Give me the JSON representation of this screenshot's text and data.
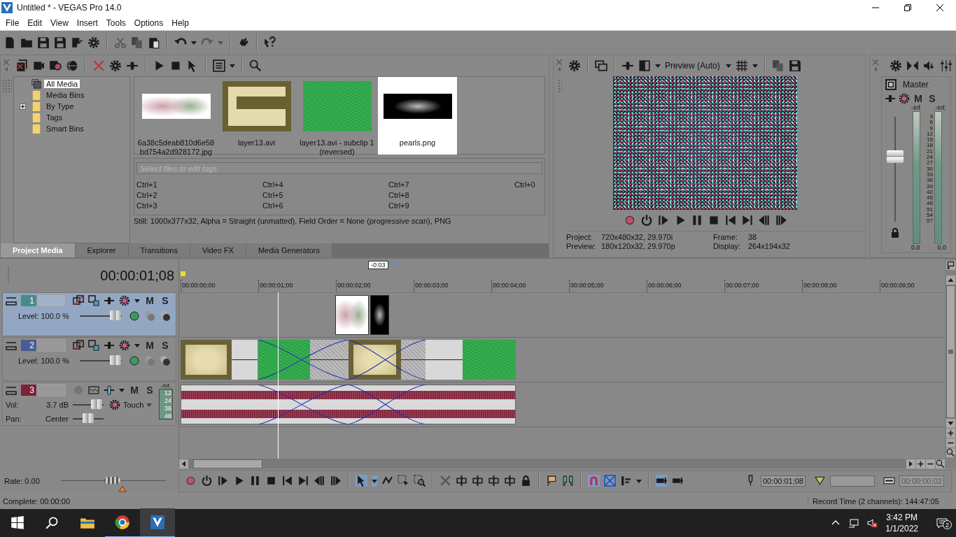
{
  "window": {
    "title": "Untitled * - VEGAS Pro 14.0"
  },
  "menu": [
    "File",
    "Edit",
    "View",
    "Insert",
    "Tools",
    "Options",
    "Help"
  ],
  "media_tree": [
    {
      "label": "All Media",
      "selected": true,
      "expandable": false
    },
    {
      "label": "Media Bins",
      "selected": false,
      "expandable": false
    },
    {
      "label": "By Type",
      "selected": false,
      "expandable": true
    },
    {
      "label": "Tags",
      "selected": false,
      "expandable": false
    },
    {
      "label": "Smart Bins",
      "selected": false,
      "expandable": false
    }
  ],
  "media_files": [
    {
      "name": "6a38c5deab810d6e58bd754a2d928172.jpg",
      "kind": "cartoon",
      "selected": false
    },
    {
      "name": "layer13.avi",
      "kind": "texture",
      "selected": false
    },
    {
      "name": "layer13.avi - subclip 1 (reversed)",
      "kind": "green",
      "selected": false
    },
    {
      "name": "pearls.png",
      "kind": "dark",
      "selected": true
    }
  ],
  "tags": {
    "placeholder": "Select files to edit tags",
    "shortcut_columns": [
      [
        "Ctrl+1",
        "Ctrl+2",
        "Ctrl+3"
      ],
      [
        "Ctrl+4",
        "Ctrl+5",
        "Ctrl+6"
      ],
      [
        "Ctrl+7",
        "Ctrl+8",
        "Ctrl+9"
      ],
      [
        "Ctrl+0"
      ]
    ]
  },
  "media_info": "Still: 1000x377x32, Alpha = Straight (unmatted), Field Order = None (progressive scan), PNG",
  "dock_tabs": [
    {
      "label": "Project Media",
      "selected": true
    },
    {
      "label": "Explorer",
      "selected": false
    },
    {
      "label": "Transitions",
      "selected": false
    },
    {
      "label": "Video FX",
      "selected": false
    },
    {
      "label": "Media Generators",
      "selected": false
    }
  ],
  "preview": {
    "quality": "Preview (Auto)",
    "info_left": [
      {
        "label": "Project:",
        "value": "720x480x32, 29.970i"
      },
      {
        "label": "Preview:",
        "value": "180x120x32, 29.970p"
      }
    ],
    "info_right": [
      {
        "label": "Frame:",
        "value": "38"
      },
      {
        "label": "Display:",
        "value": "264x194x32"
      }
    ]
  },
  "master": {
    "title": "Master",
    "mute": "M",
    "solo": "S",
    "peaks": [
      "-Inf.",
      "-Inf."
    ],
    "scale": [
      "3",
      "6",
      "9",
      "12",
      "15",
      "18",
      "21",
      "24",
      "27",
      "30",
      "33",
      "36",
      "39",
      "42",
      "45",
      "48",
      "51",
      "54",
      "57"
    ],
    "readings": [
      "0.0",
      "0.0"
    ],
    "level": 0.62
  },
  "timeline": {
    "time": "00:00:01;08",
    "cursor_offset": "-0:03",
    "ruler": [
      "00:00:00;00",
      "00:00:01;00",
      "00:00:02;00",
      "00:00:03;00",
      "00:00:04;00",
      "00:00:05;00",
      "00:00:06;00",
      "00:00:07;00",
      "00:00:08;00",
      "00:00:09;00"
    ],
    "tracks": [
      {
        "number": "1",
        "kind": "video",
        "selected": true,
        "mute": "M",
        "solo": "S",
        "fader": {
          "label": "Level: 100.0 %",
          "level": 0.85
        }
      },
      {
        "number": "2",
        "kind": "video",
        "selected": false,
        "mute": "M",
        "solo": "S",
        "fader": {
          "label": "Level: 100.0 %",
          "level": 0.85
        }
      },
      {
        "number": "3",
        "kind": "audio",
        "selected": false,
        "mute": "M",
        "solo": "S",
        "peak": "-Inf.",
        "meter_scale": [
          "12",
          "24",
          "36",
          "48"
        ],
        "automation": "Touch",
        "volume": {
          "label": "Vol:",
          "value": "3.7 dB",
          "level": 0.78
        },
        "pan": {
          "label": "Pan:",
          "value": "Center",
          "level": 0.5
        }
      }
    ],
    "rate": {
      "label": "Rate: 0.00",
      "level": 0.5
    },
    "cursor_time": "00:00:01;08",
    "selection_length": "00:00:00;02"
  },
  "status_bar": {
    "left": "Complete: 00:00:00",
    "right": "Record Time (2 channels): 144:47:05"
  },
  "taskbar": {
    "time": "3:42 PM",
    "date": "1/1/2022",
    "notifications": "2"
  }
}
